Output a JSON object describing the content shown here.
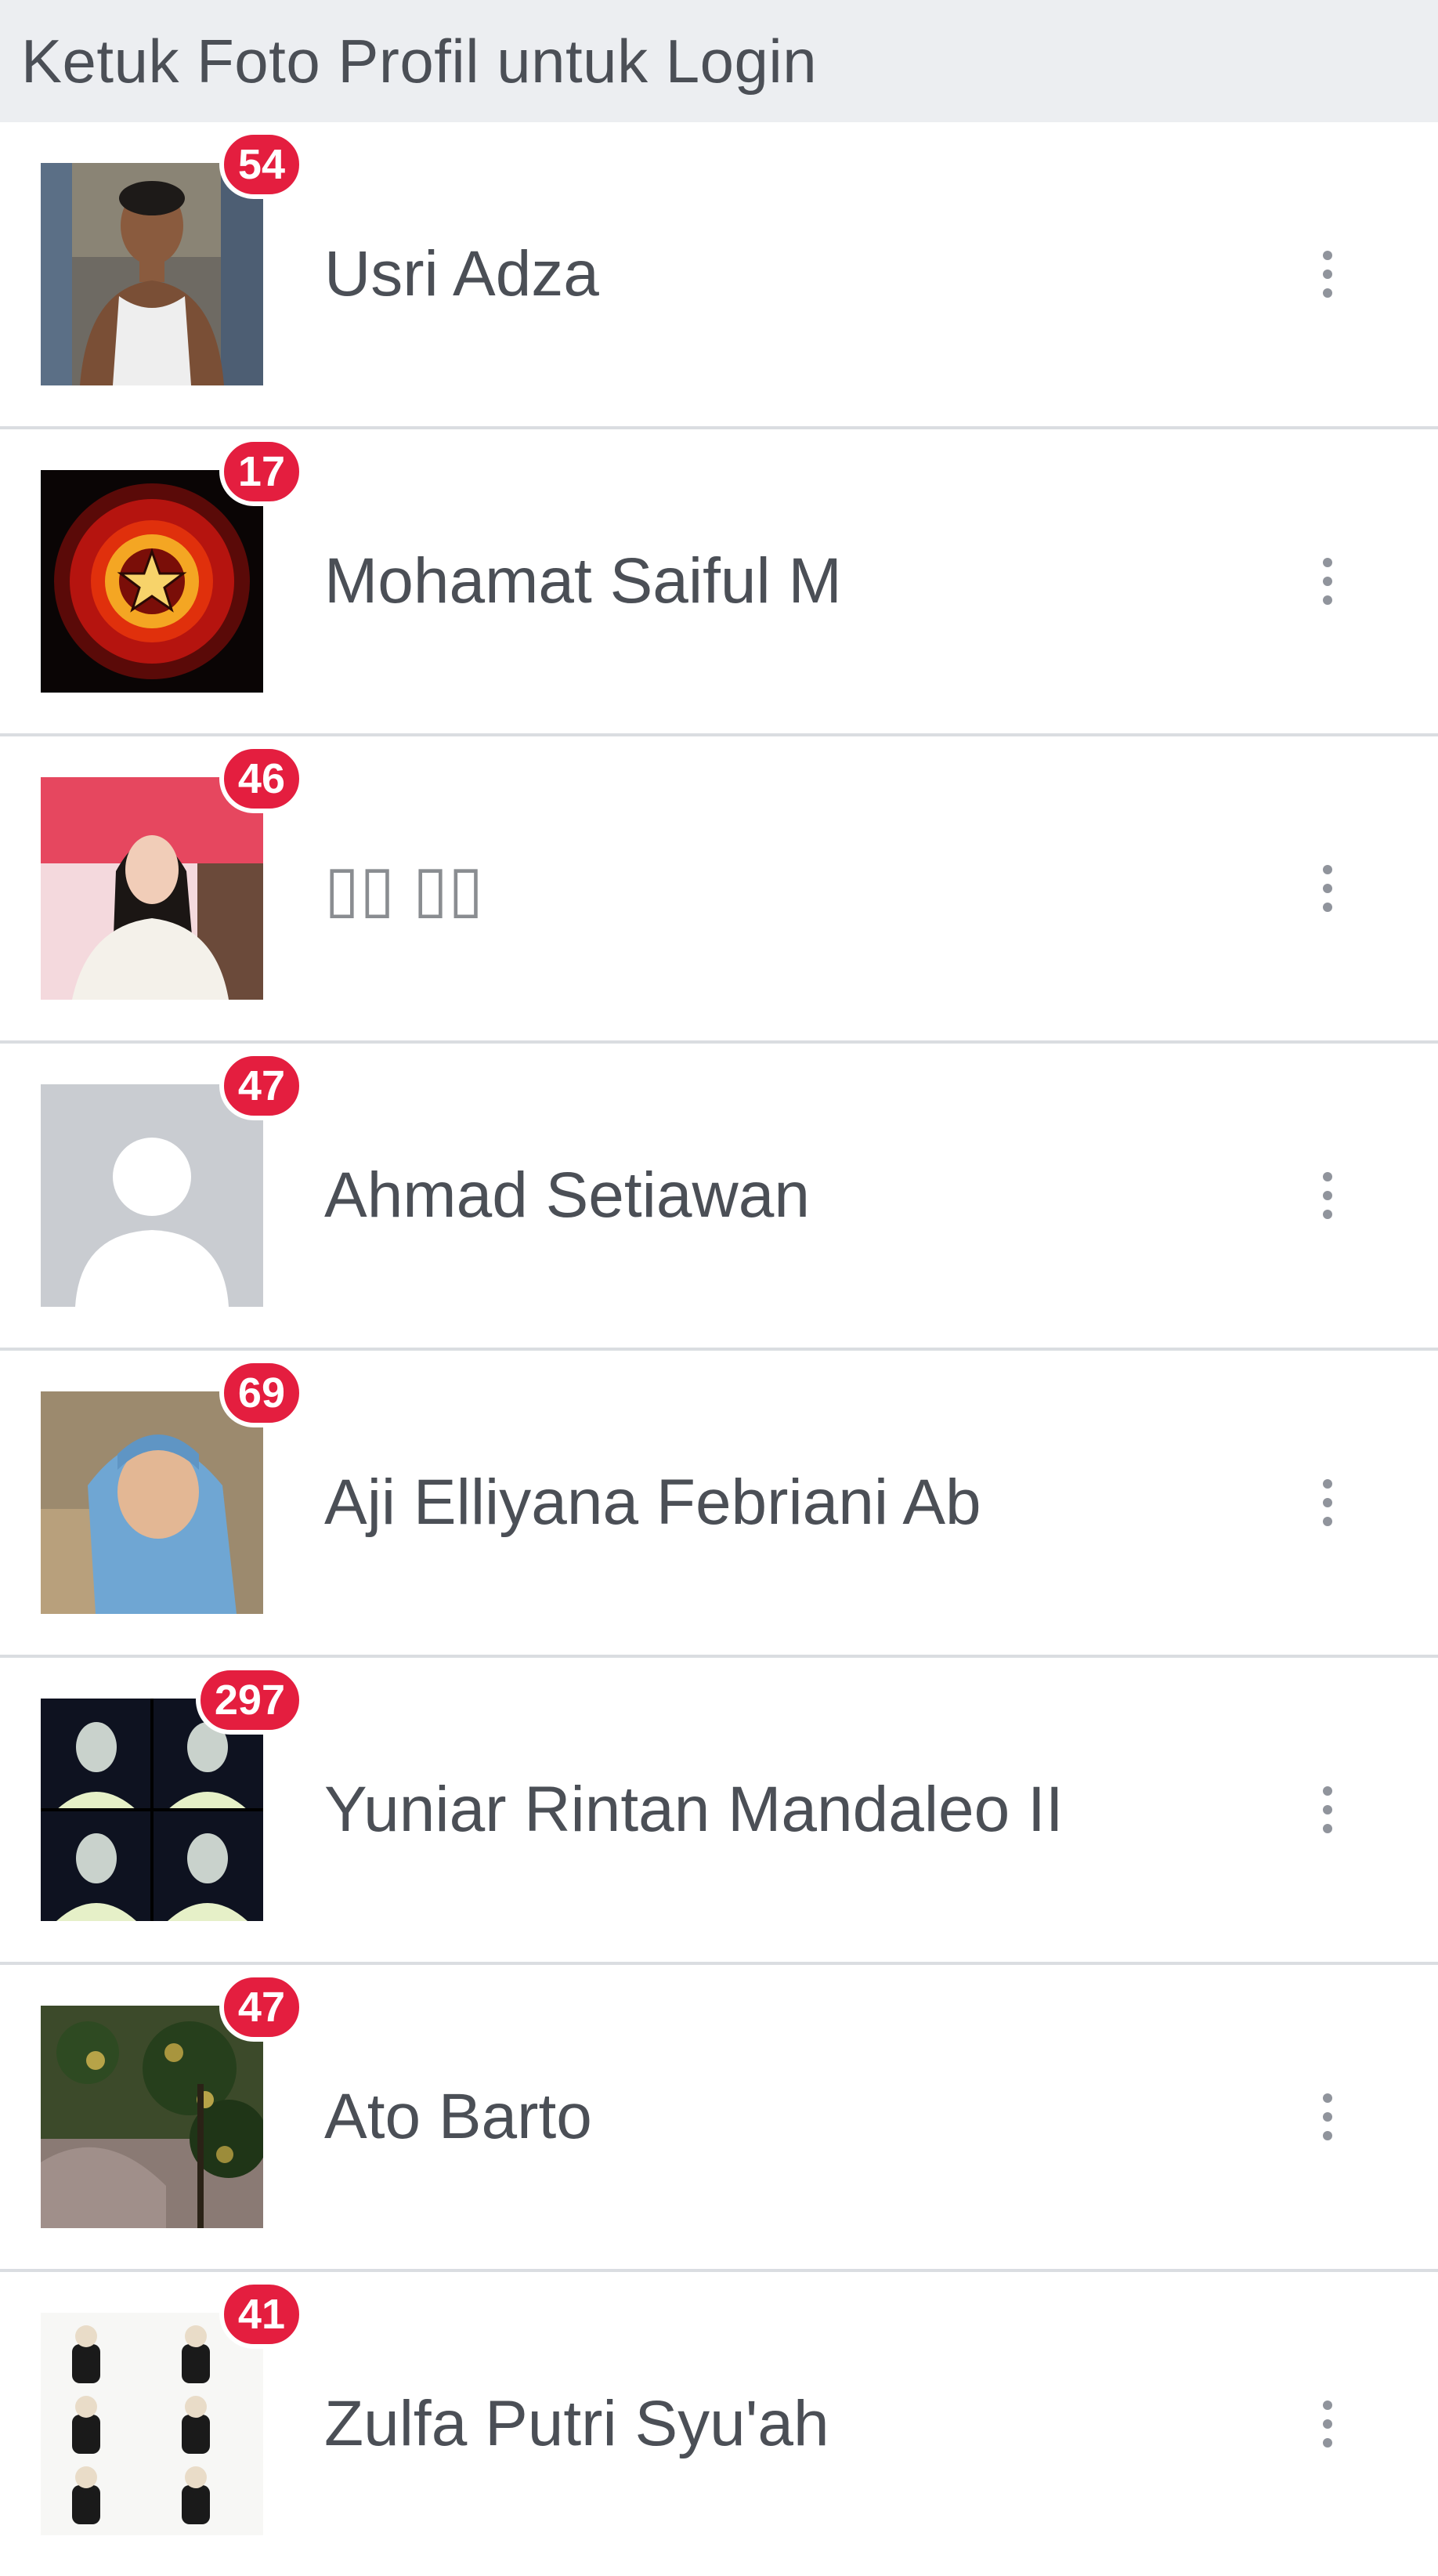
{
  "header": {
    "title": "Ketuk Foto Profil untuk Login"
  },
  "accounts": [
    {
      "name": "Usri Adza",
      "badge": "54",
      "avatar": "photo-man-white-tank-top"
    },
    {
      "name": "Mohamat Saiful M",
      "badge": "17",
      "avatar": "red-star-emblem"
    },
    {
      "name": "▯▯ ▯▯",
      "badge": "46",
      "avatar": "photo-girl-white-sweater"
    },
    {
      "name": "Ahmad Setiawan",
      "badge": "47",
      "avatar": "default-silhouette"
    },
    {
      "name": "Aji Elliyana Febriani Ab",
      "badge": "69",
      "avatar": "photo-girl-blue-hijab"
    },
    {
      "name": "Yuniar Rintan Mandaleo II",
      "badge": "297",
      "avatar": "photo-collage-four"
    },
    {
      "name": "Ato Barto",
      "badge": "47",
      "avatar": "photo-fruit-tree"
    },
    {
      "name": "Zulfa Putri Syu'ah",
      "badge": "41",
      "avatar": "photo-collage-six-poses"
    }
  ],
  "colors": {
    "badge": "#e41e3f",
    "text": "#4b4f56",
    "menu_dots": "#90949c",
    "divider": "#dadde1",
    "header_bg": "#eceef1"
  }
}
